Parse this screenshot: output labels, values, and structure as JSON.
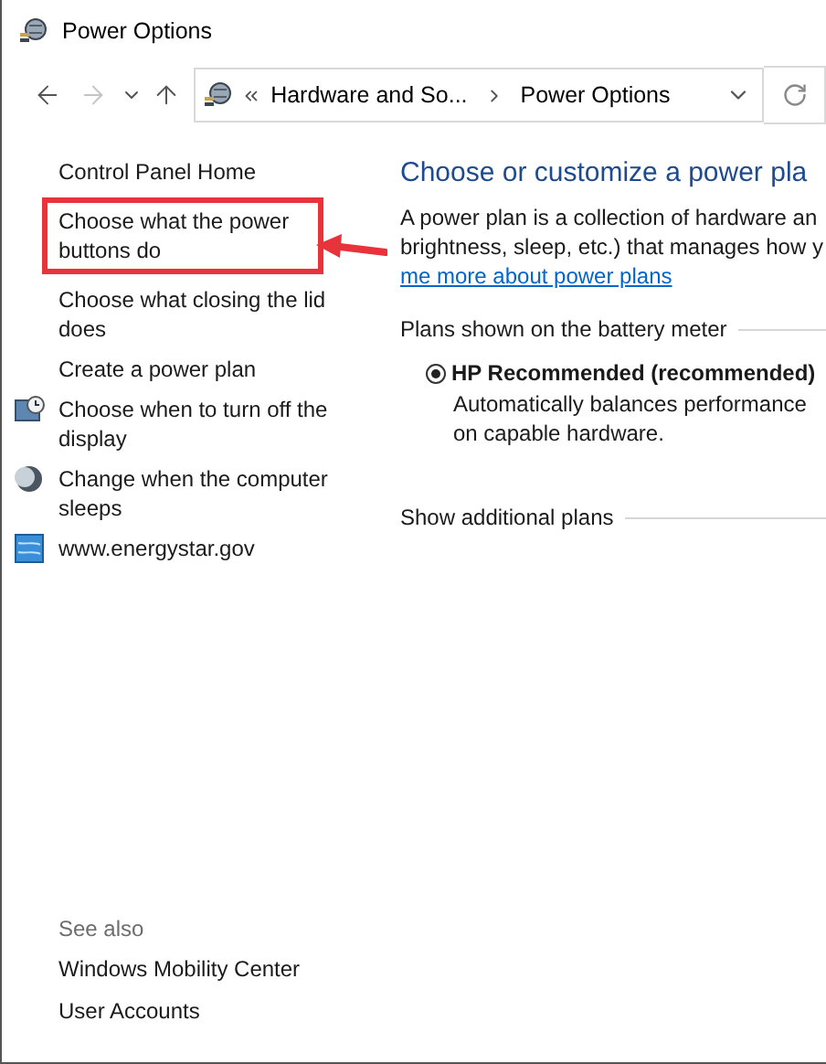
{
  "window": {
    "title": "Power Options"
  },
  "navigation": {
    "back_enabled": true,
    "forward_enabled": false,
    "breadcrumb": [
      {
        "label": "Hardware and So..."
      },
      {
        "label": "Power Options"
      }
    ]
  },
  "sidebar": {
    "items": [
      {
        "label": "Control Panel Home",
        "kind": "text",
        "highlighted": false
      },
      {
        "label": "Choose what the power buttons do",
        "kind": "text",
        "highlighted": true
      },
      {
        "label": "Choose what closing the lid does",
        "kind": "text",
        "highlighted": false
      },
      {
        "label": "Create a power plan",
        "kind": "text",
        "highlighted": false
      },
      {
        "label": "Choose when to turn off the display",
        "kind": "display",
        "highlighted": false
      },
      {
        "label": "Change when the computer sleeps",
        "kind": "sleep",
        "highlighted": false
      },
      {
        "label": "www.energystar.gov",
        "kind": "website",
        "highlighted": false
      }
    ],
    "see_also": {
      "title": "See also",
      "items": [
        {
          "label": "Windows Mobility Center"
        },
        {
          "label": "User Accounts"
        }
      ]
    }
  },
  "main": {
    "heading": "Choose or customize a power pla",
    "description_lines": [
      "A power plan is a collection of hardware an",
      "brightness, sleep, etc.) that manages how y"
    ],
    "link": "me more about power plans",
    "battery_meter": {
      "title": "Plans shown on the battery meter",
      "plans": [
        {
          "name": "HP Recommended (recommended)",
          "selected": true,
          "description_lines": [
            "Automatically balances performance",
            "on capable hardware."
          ]
        }
      ]
    },
    "additional_plans": {
      "title": "Show additional plans"
    }
  }
}
